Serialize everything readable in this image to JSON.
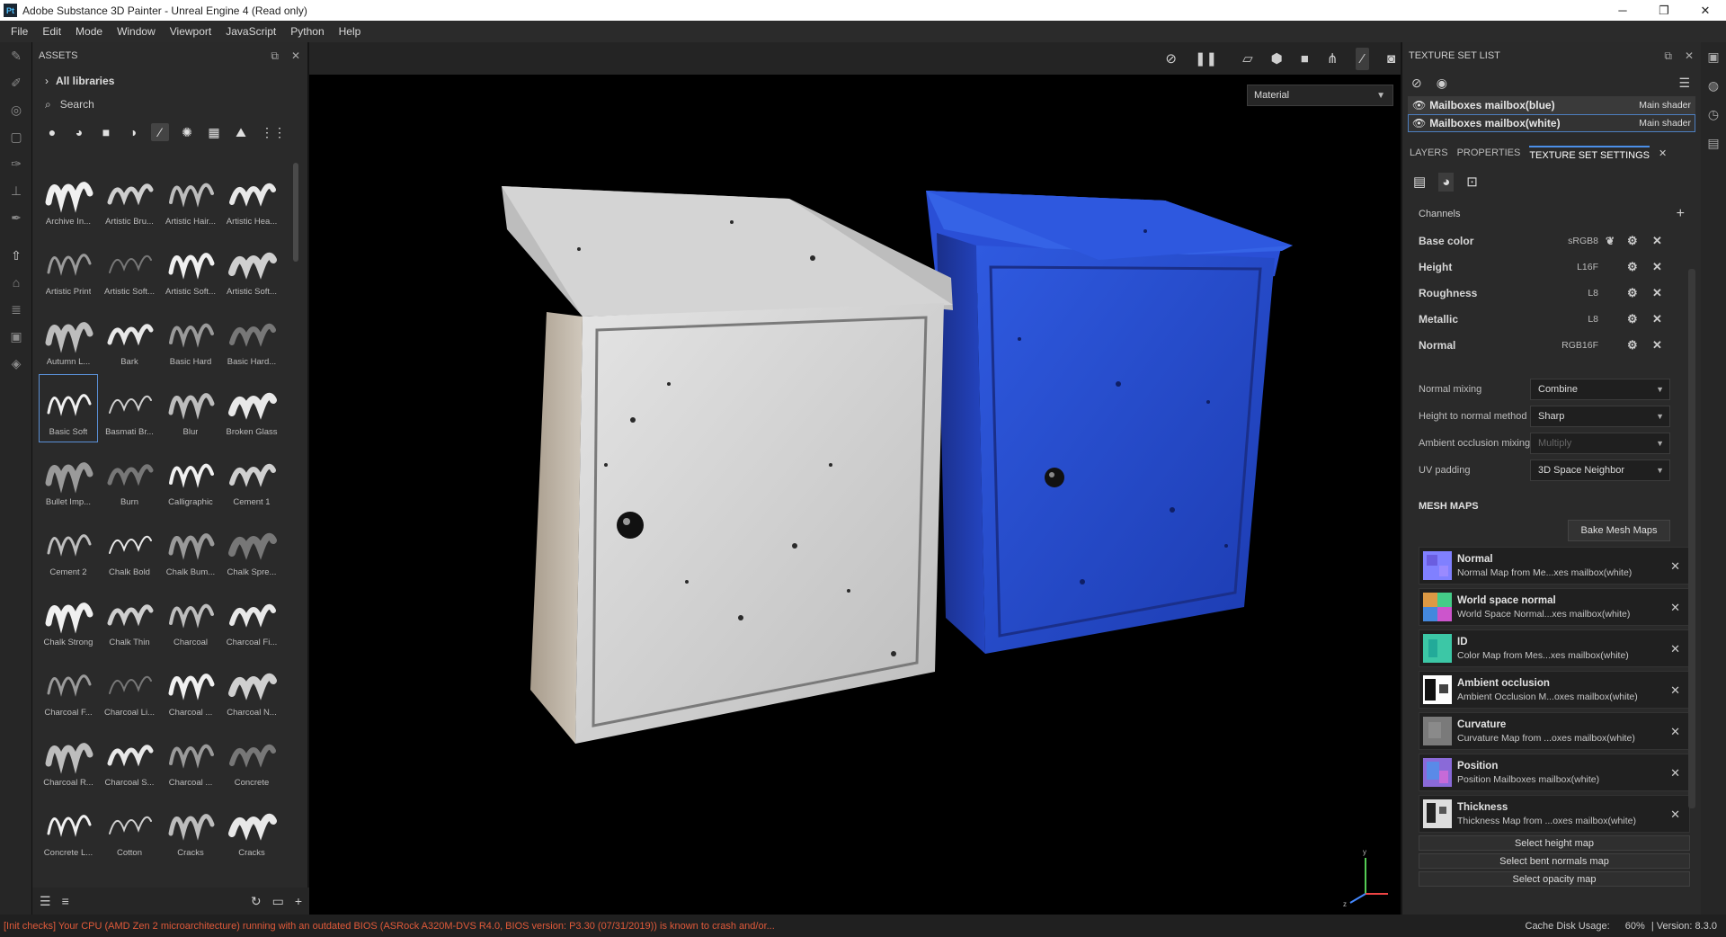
{
  "window": {
    "title": "Adobe Substance 3D Painter - Unreal Engine 4 (Read only)",
    "logo": "Pt"
  },
  "menu": [
    "File",
    "Edit",
    "Mode",
    "Window",
    "Viewport",
    "JavaScript",
    "Python",
    "Help"
  ],
  "assets": {
    "title": "ASSETS",
    "libraries": "All libraries",
    "search_placeholder": "Search",
    "items": [
      "Archive In...",
      "Artistic Bru...",
      "Artistic Hair...",
      "Artistic Hea...",
      "Artistic Print",
      "Artistic Soft...",
      "Artistic Soft...",
      "Artistic Soft...",
      "Autumn L...",
      "Bark",
      "Basic Hard",
      "Basic Hard...",
      "Basic Soft",
      "Basmati Br...",
      "Blur",
      "Broken Glass",
      "Bullet Imp...",
      "Burn",
      "Calligraphic",
      "Cement 1",
      "Cement 2",
      "Chalk Bold",
      "Chalk Bum...",
      "Chalk Spre...",
      "Chalk Strong",
      "Chalk Thin",
      "Charcoal",
      "Charcoal Fi...",
      "Charcoal F...",
      "Charcoal Li...",
      "Charcoal ...",
      "Charcoal N...",
      "Charcoal R...",
      "Charcoal S...",
      "Charcoal ...",
      "Concrete",
      "Concrete L...",
      "Cotton",
      "Cracks",
      "Cracks"
    ]
  },
  "viewport": {
    "mode_select": "Material"
  },
  "texture_set_list": {
    "title": "TEXTURE SET LIST",
    "sets": [
      {
        "name": "Mailboxes mailbox(blue)",
        "shader": "Main shader"
      },
      {
        "name": "Mailboxes mailbox(white)",
        "shader": "Main shader"
      }
    ]
  },
  "tabs": [
    "LAYERS",
    "PROPERTIES",
    "TEXTURE SET SETTINGS"
  ],
  "channels": {
    "header": "Channels",
    "items": [
      {
        "name": "Base color",
        "format": "sRGB8"
      },
      {
        "name": "Height",
        "format": "L16F"
      },
      {
        "name": "Roughness",
        "format": "L8"
      },
      {
        "name": "Metallic",
        "format": "L8"
      },
      {
        "name": "Normal",
        "format": "RGB16F"
      }
    ]
  },
  "settings": [
    {
      "label": "Normal mixing",
      "value": "Combine"
    },
    {
      "label": "Height to normal method",
      "value": "Sharp"
    },
    {
      "label": "Ambient occlusion mixing",
      "value": "Multiply"
    },
    {
      "label": "UV padding",
      "value": "3D Space Neighbor"
    }
  ],
  "mesh_maps": {
    "header": "MESH MAPS",
    "bake_button": "Bake Mesh Maps",
    "items": [
      {
        "name": "Normal",
        "desc": "Normal Map from Me...xes mailbox(white)"
      },
      {
        "name": "World space normal",
        "desc": "World Space Normal...xes mailbox(white)"
      },
      {
        "name": "ID",
        "desc": "Color Map from Mes...xes mailbox(white)"
      },
      {
        "name": "Ambient occlusion",
        "desc": "Ambient Occlusion M...oxes mailbox(white)"
      },
      {
        "name": "Curvature",
        "desc": "Curvature Map from ...oxes mailbox(white)"
      },
      {
        "name": "Position",
        "desc": "Position Mailboxes mailbox(white)"
      },
      {
        "name": "Thickness",
        "desc": "Thickness Map from ...oxes mailbox(white)"
      }
    ],
    "select_buttons": [
      "Select height map",
      "Select bent normals map",
      "Select opacity map"
    ]
  },
  "status": {
    "error": "[Init checks] Your CPU (AMD Zen 2 microarchitecture) running with an outdated BIOS (ASRock A320M-DVS R4.0, BIOS version: P3.30 (07/31/2019)) is known to crash and/or...",
    "cache": "Cache Disk Usage:",
    "cache_value": "60%",
    "version": "| Version: 8.3.0"
  },
  "colors": {
    "accent": "#4b8fe8",
    "error": "#e05a3a",
    "mailbox_blue": "#2547c9",
    "mailbox_white": "#cfcfcf"
  }
}
